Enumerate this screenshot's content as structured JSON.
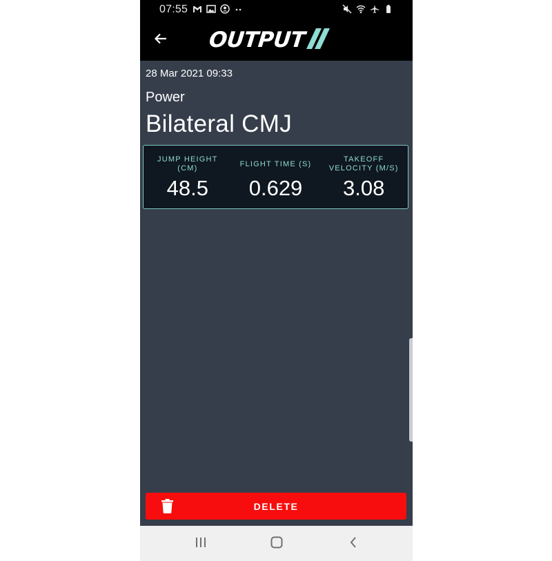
{
  "status_bar": {
    "time": "07:55",
    "left_icons": [
      "gmail-icon",
      "gallery-icon",
      "account-icon",
      "more-dots-icon"
    ],
    "right_icons": [
      "mute-icon",
      "wifi-icon",
      "airplane-icon",
      "battery-icon"
    ]
  },
  "app_bar": {
    "logo_text": "OUTPUT",
    "back_icon": "arrow-left-icon"
  },
  "session": {
    "date": "28 Mar 2021 09:33",
    "category": "Power",
    "title": "Bilateral CMJ"
  },
  "metrics": [
    {
      "label": "JUMP HEIGHT (CM)",
      "value": "48.5"
    },
    {
      "label": "FLIGHT TIME (S)",
      "value": "0.629"
    },
    {
      "label": "TAKEOFF VELOCITY (M/S)",
      "value": "3.08"
    }
  ],
  "actions": {
    "delete_label": "DELETE"
  },
  "nav": [
    "recent-apps-icon",
    "home-icon",
    "back-icon"
  ],
  "colors": {
    "background": "#363e4b",
    "accent": "#8fdcd3",
    "danger": "#f70d0d",
    "card": "#0f1720"
  }
}
